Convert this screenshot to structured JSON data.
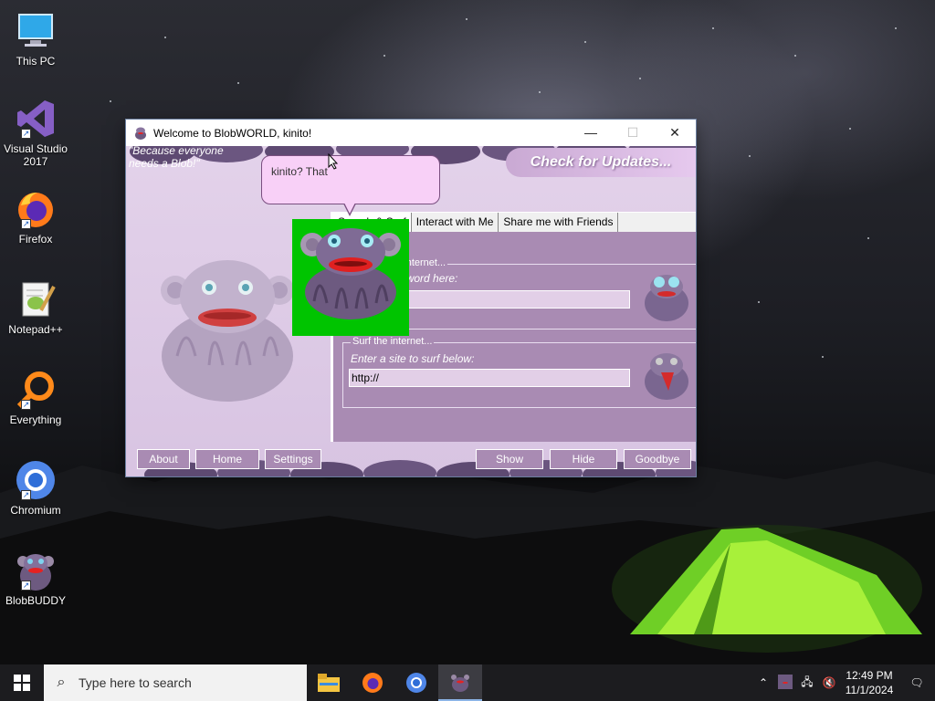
{
  "desktop": {
    "icons": [
      {
        "label": "This PC"
      },
      {
        "label": "Visual Studio 2017"
      },
      {
        "label": "Firefox"
      },
      {
        "label": "Notepad++"
      },
      {
        "label": "Everything"
      },
      {
        "label": "Chromium"
      },
      {
        "label": "BlobBUDDY"
      }
    ]
  },
  "window": {
    "title": "Welcome to BlobWORLD, kinito!",
    "slogan_line1": "\"Because everyone",
    "slogan_line2": "needs a Blob!\"",
    "update_button": "Check for Updates...",
    "tabs": [
      "Search & Surf",
      "Interact with Me",
      "Share me with Friends"
    ],
    "search_group": {
      "legend": "Search the internet...",
      "hint": "Enter a keyword here:",
      "value": ""
    },
    "surf_group": {
      "legend": "Surf the internet...",
      "hint": "Enter a site to surf below:",
      "value": "http://"
    },
    "buttons": {
      "about": "About",
      "home": "Home",
      "settings": "Settings",
      "show": "Show",
      "hide": "Hide",
      "goodbye": "Goodbye"
    }
  },
  "speech_bubble": {
    "text": "kinito? That"
  },
  "taskbar": {
    "search_placeholder": "Type here to search",
    "time": "12:49 PM",
    "date": "11/1/2024"
  },
  "colors": {
    "window_bg": "#e3d2ea",
    "panel_bg": "#a98bb3",
    "bubble_bg": "#f8d0f7",
    "green_screen": "#00c400"
  }
}
